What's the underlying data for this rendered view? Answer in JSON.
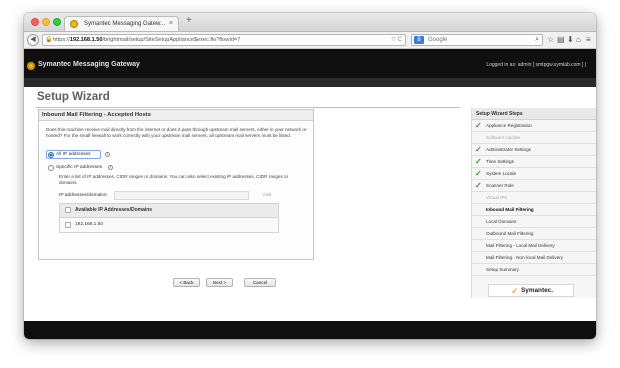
{
  "browser": {
    "tab_title": "Symantec Messaging Gatew...",
    "tab_close": "×",
    "new_tab": "+",
    "url_prefix": "https://",
    "url_host": "192.168.1.50",
    "url_path": "/brightmail/setup/SiteSetupAppliance$exec.flo?flowId=7",
    "url_icons": "▽ C",
    "search_placeholder": "Google",
    "search_engine_letter": "8",
    "toolbar_icons": [
      "star-icon",
      "bookmarks-icon",
      "download-icon",
      "home-icon",
      "menu-icon"
    ]
  },
  "app": {
    "title": "Symantec Messaging Gateway",
    "logged_in": "Logged in as:  admin [ smtpgw.symlab.com ]  |"
  },
  "page": {
    "heading": "Setup Wizard"
  },
  "panel": {
    "title": "Inbound Mail Filtering - Accepted Hosts",
    "question": "Does this machine receive mail directly from the internet or does it pass through upstream mail servers, either in your network or hosted? For the small firewall to work correctly with your upstream mail servers, all upstream mail servers must be listed.",
    "option_all": "All IP addresses",
    "option_specific": "Specific IP addresses",
    "selected_option": "All IP addresses",
    "specific_description": "Enter a list of IP addresses, CIDR ranges or domains. You can also select existing IP addresses, CIDR ranges or domains.",
    "ip_field_label": "IP addresses/domains:",
    "ip_field_value": "",
    "add_button": "Add",
    "table": {
      "header": "Available IP Addresses/Domains",
      "rows": [
        "192.168.1.50"
      ]
    }
  },
  "buttons": {
    "back": "< Back",
    "next": "Next >",
    "cancel": "Cancel"
  },
  "steps": {
    "title": "Setup Wizard Steps",
    "items": [
      {
        "label": "Appliance Registration",
        "status": "done"
      },
      {
        "label": "Software Update",
        "status": "disabled"
      },
      {
        "label": "Administrator Settings",
        "status": "done"
      },
      {
        "label": "Time Settings",
        "status": "done"
      },
      {
        "label": "System Locale",
        "status": "done"
      },
      {
        "label": "Scanner Role",
        "status": "done"
      },
      {
        "label": "Virtual IPs",
        "status": "disabled"
      },
      {
        "label": "Inbound Mail Filtering",
        "status": "current"
      },
      {
        "label": "Local Domains",
        "status": "pending"
      },
      {
        "label": "Outbound Mail Filtering",
        "status": "pending"
      },
      {
        "label": "Mail Filtering - Local Mail Delivery",
        "status": "pending"
      },
      {
        "label": "Mail Filtering - Non-local Mail Delivery",
        "status": "pending"
      },
      {
        "label": "Setup Summary",
        "status": "pending"
      }
    ],
    "vendor_logo": "Symantec."
  },
  "colors": {
    "header_bg": "#0f0f0f",
    "accent_yellow": "#f4b71d",
    "check_green": "#3a9a2e",
    "radio_blue": "#2a6ac8"
  }
}
